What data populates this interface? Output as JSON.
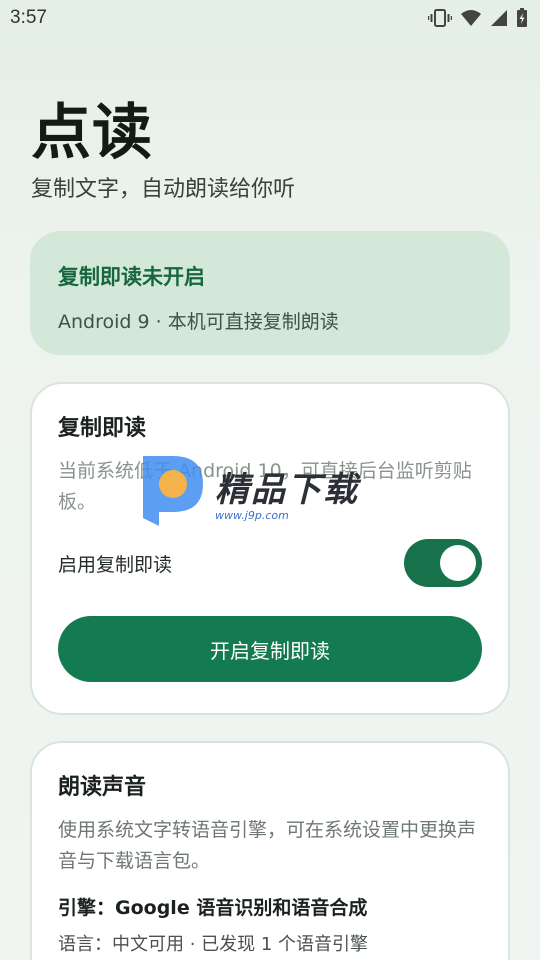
{
  "status_bar": {
    "time": "3:57"
  },
  "header": {
    "title": "点读",
    "subtitle": "复制文字，自动朗读给你听"
  },
  "status_card": {
    "title": "复制即读未开启",
    "detail": "Android 9 · 本机可直接复制朗读"
  },
  "copy_card": {
    "title": "复制即读",
    "description": "当前系统低于 Android 10，可直接后台监听剪贴板。",
    "toggle_label": "启用复制即读",
    "toggle_on": true,
    "button_label": "开启复制即读"
  },
  "voice_card": {
    "title": "朗读声音",
    "description": "使用系统文字转语音引擎，可在系统设置中更换声音与下载语言包。",
    "engine": "引擎：Google 语音识别和语音合成",
    "language": "语言：中文可用 · 已发现 1 个语音引擎"
  },
  "watermark": {
    "title": "精品下载",
    "url": "www.j9p.com"
  },
  "colors": {
    "accent": "#147a50",
    "status_card_bg": "#d3e8d9",
    "status_card_title": "#17673d"
  },
  "icons": [
    "vibrate-icon",
    "wifi-icon",
    "signal-icon",
    "battery-icon"
  ]
}
